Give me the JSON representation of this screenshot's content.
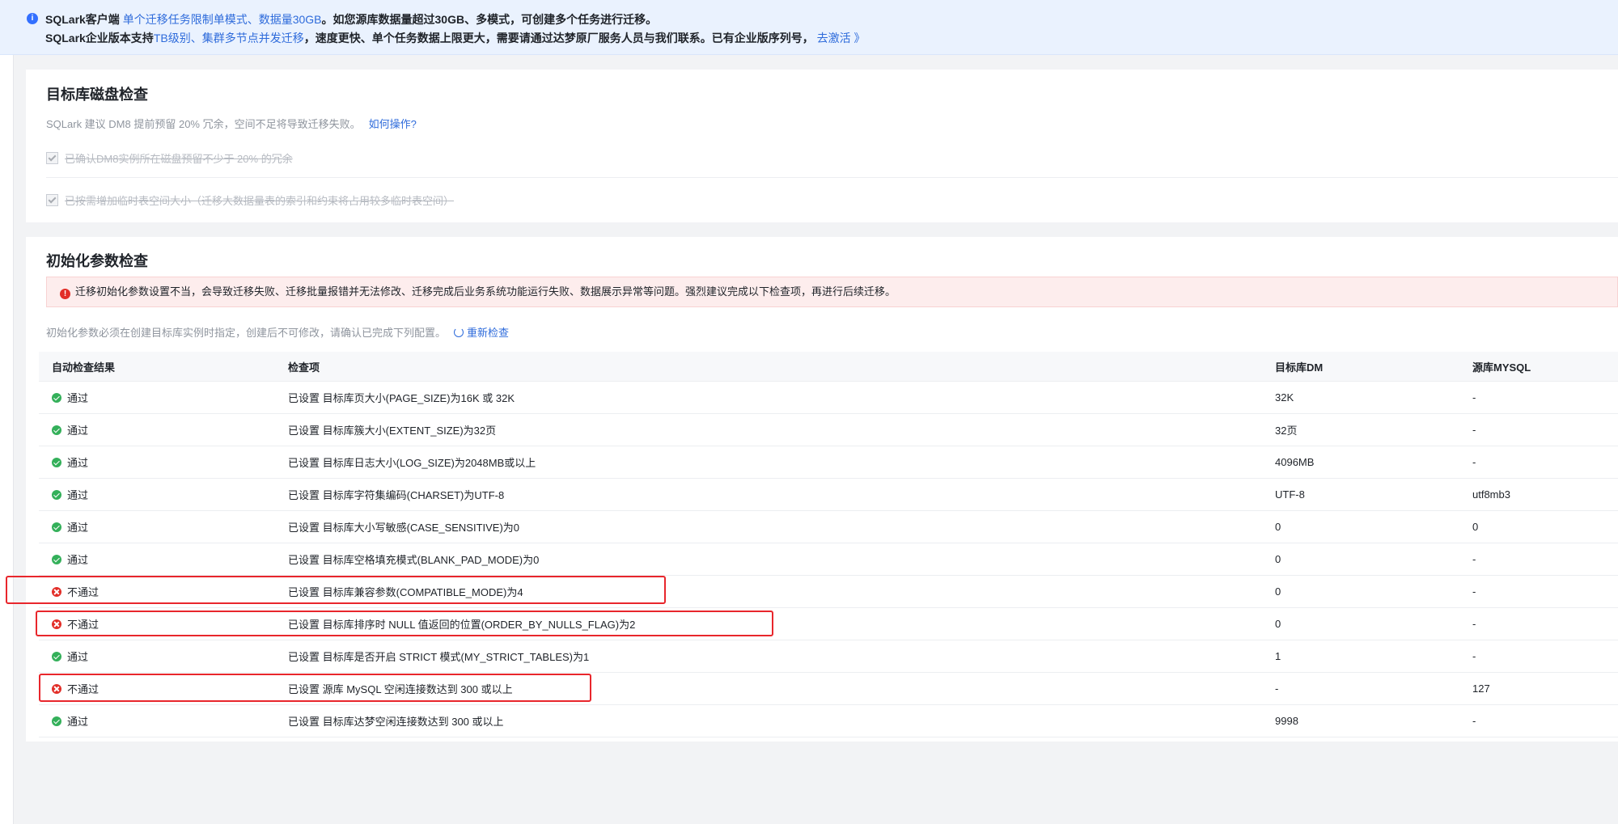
{
  "notice": {
    "line1": {
      "pre": "SQLark客户端 ",
      "hl1": "单个迁移任务限制单模式",
      "sep": "、",
      "hl2": "数据量30GB",
      "post": "。如您源库数据量超过30GB、多模式，可创建多个任务进行迁移。"
    },
    "line2": {
      "pre": "SQLark企业版本支持",
      "hl1": "TB级别",
      "sep": "、",
      "hl2": "集群多节点并发迁移",
      "post": "，速度更快、单个任务数据上限更大，需要请通过达梦原厂服务人员与我们联系。已有企业版序列号，",
      "link": "去激活 》"
    }
  },
  "disk_check": {
    "title": "目标库磁盘检查",
    "hint": "SQLark 建议 DM8 提前预留 20% 冗余，空间不足将导致迁移失败。",
    "hint_link": "如何操作?",
    "checks": [
      "已确认DM8实例所在磁盘预留不少于 20% 的冗余",
      "已按需增加临时表空间大小（迁移大数据量表的索引和约束将占用较多临时表空间）"
    ]
  },
  "init_check": {
    "title": "初始化参数检查",
    "alert": "迁移初始化参数设置不当，会导致迁移失败、迁移批量报错并无法修改、迁移完成后业务系统功能运行失败、数据展示异常等问题。强烈建议完成以下检查项，再进行后续迁移。",
    "hint": "初始化参数必须在创建目标库实例时指定，创建后不可修改，请确认已完成下列配置。",
    "refresh": "重新检查",
    "columns": [
      "自动检查结果",
      "检查项",
      "目标库DM",
      "源库MYSQL"
    ],
    "rows": [
      {
        "status": "通过",
        "ok": true,
        "item": "已设置 目标库页大小(PAGE_SIZE)为16K 或 32K",
        "dm": "32K",
        "mysql": "-"
      },
      {
        "status": "通过",
        "ok": true,
        "item": "已设置 目标库簇大小(EXTENT_SIZE)为32页",
        "dm": "32页",
        "mysql": "-"
      },
      {
        "status": "通过",
        "ok": true,
        "item": "已设置 目标库日志大小(LOG_SIZE)为2048MB或以上",
        "dm": "4096MB",
        "mysql": "-"
      },
      {
        "status": "通过",
        "ok": true,
        "item": "已设置 目标库字符集编码(CHARSET)为UTF-8",
        "dm": "UTF-8",
        "mysql": "utf8mb3"
      },
      {
        "status": "通过",
        "ok": true,
        "item": "已设置 目标库大小写敏感(CASE_SENSITIVE)为0",
        "dm": "0",
        "mysql": "0"
      },
      {
        "status": "通过",
        "ok": true,
        "item": "已设置 目标库空格填充模式(BLANK_PAD_MODE)为0",
        "dm": "0",
        "mysql": "-"
      },
      {
        "status": "不通过",
        "ok": false,
        "item": "已设置 目标库兼容参数(COMPATIBLE_MODE)为4",
        "dm": "0",
        "mysql": "-"
      },
      {
        "status": "不通过",
        "ok": false,
        "item": "已设置 目标库排序时 NULL 值返回的位置(ORDER_BY_NULLS_FLAG)为2",
        "dm": "0",
        "mysql": "-"
      },
      {
        "status": "通过",
        "ok": true,
        "item": "已设置 目标库是否开启 STRICT 模式(MY_STRICT_TABLES)为1",
        "dm": "1",
        "mysql": "-"
      },
      {
        "status": "不通过",
        "ok": false,
        "item": "已设置 源库 MySQL 空闲连接数达到 300 或以上",
        "dm": "-",
        "mysql": "127"
      },
      {
        "status": "通过",
        "ok": true,
        "item": "已设置 目标库达梦空闲连接数达到 300 或以上",
        "dm": "9998",
        "mysql": "-"
      }
    ]
  },
  "colors": {
    "link": "#2e6bdb",
    "pass": "#34b05a",
    "fail": "#e22e28",
    "alert_bg": "#fdeded",
    "notice_bg": "#eaf2fe"
  }
}
